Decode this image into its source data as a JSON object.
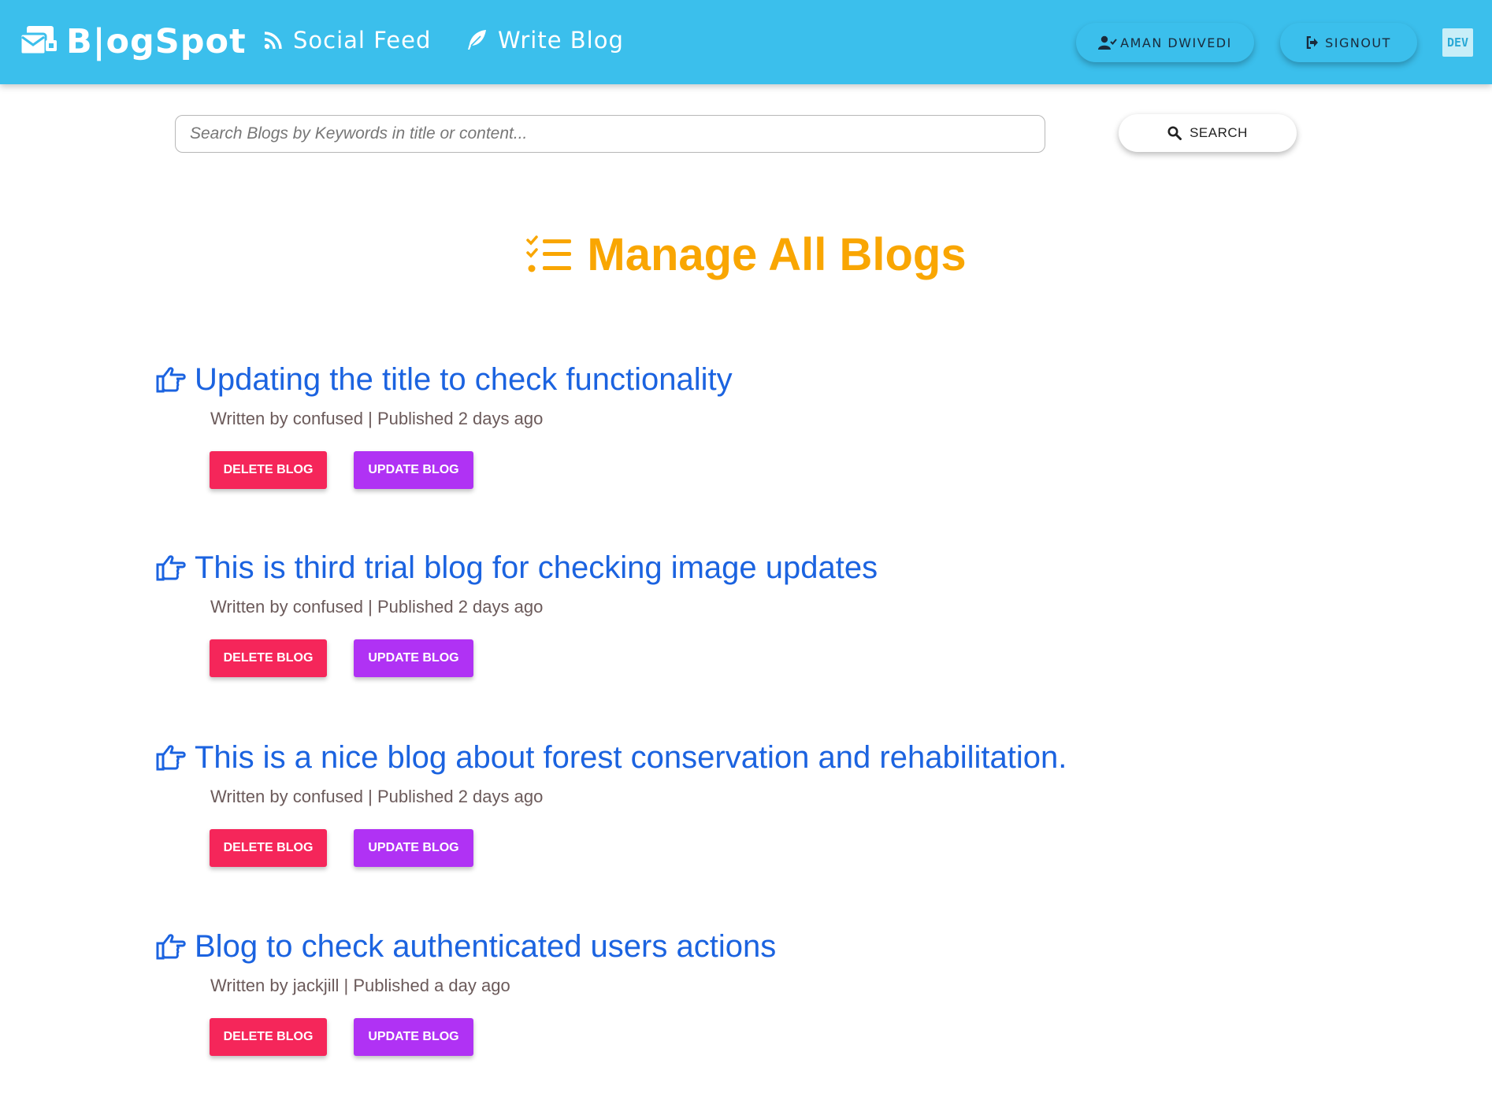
{
  "navbar": {
    "brand": "B|ogSpot",
    "links": [
      {
        "label": "Social Feed",
        "icon": "rss-icon"
      },
      {
        "label": "Write Blog",
        "icon": "feather-icon"
      }
    ],
    "user_label": "AMAN DWIVEDI",
    "signout_label": "SIGNOUT",
    "dev_badge": "DEV",
    "color": "#3bbfec"
  },
  "search": {
    "placeholder": "Search Blogs by Keywords in title or content...",
    "value": "",
    "button_label": "SEARCH"
  },
  "page": {
    "title": "Manage All Blogs",
    "title_color": "#f9a602"
  },
  "blogs": [
    {
      "title": "Updating the title to check functionality",
      "meta": "Written by confused | Published 2 days ago",
      "delete_label": "DELETE BLOG",
      "update_label": "UPDATE BLOG"
    },
    {
      "title": "This is third trial blog for checking image updates",
      "meta": "Written by confused | Published 2 days ago",
      "delete_label": "DELETE BLOG",
      "update_label": "UPDATE BLOG"
    },
    {
      "title": "This is a nice blog about forest conservation and rehabilitation.",
      "meta": "Written by confused | Published 2 days ago",
      "delete_label": "DELETE BLOG",
      "update_label": "UPDATE BLOG"
    },
    {
      "title": "Blog to check authenticated users actions",
      "meta": "Written by jackjill | Published a day ago",
      "delete_label": "DELETE BLOG",
      "update_label": "UPDATE BLOG"
    }
  ],
  "colors": {
    "link_blue": "#1b63e0",
    "delete_red": "#f5265a",
    "update_purple": "#b032f4"
  }
}
